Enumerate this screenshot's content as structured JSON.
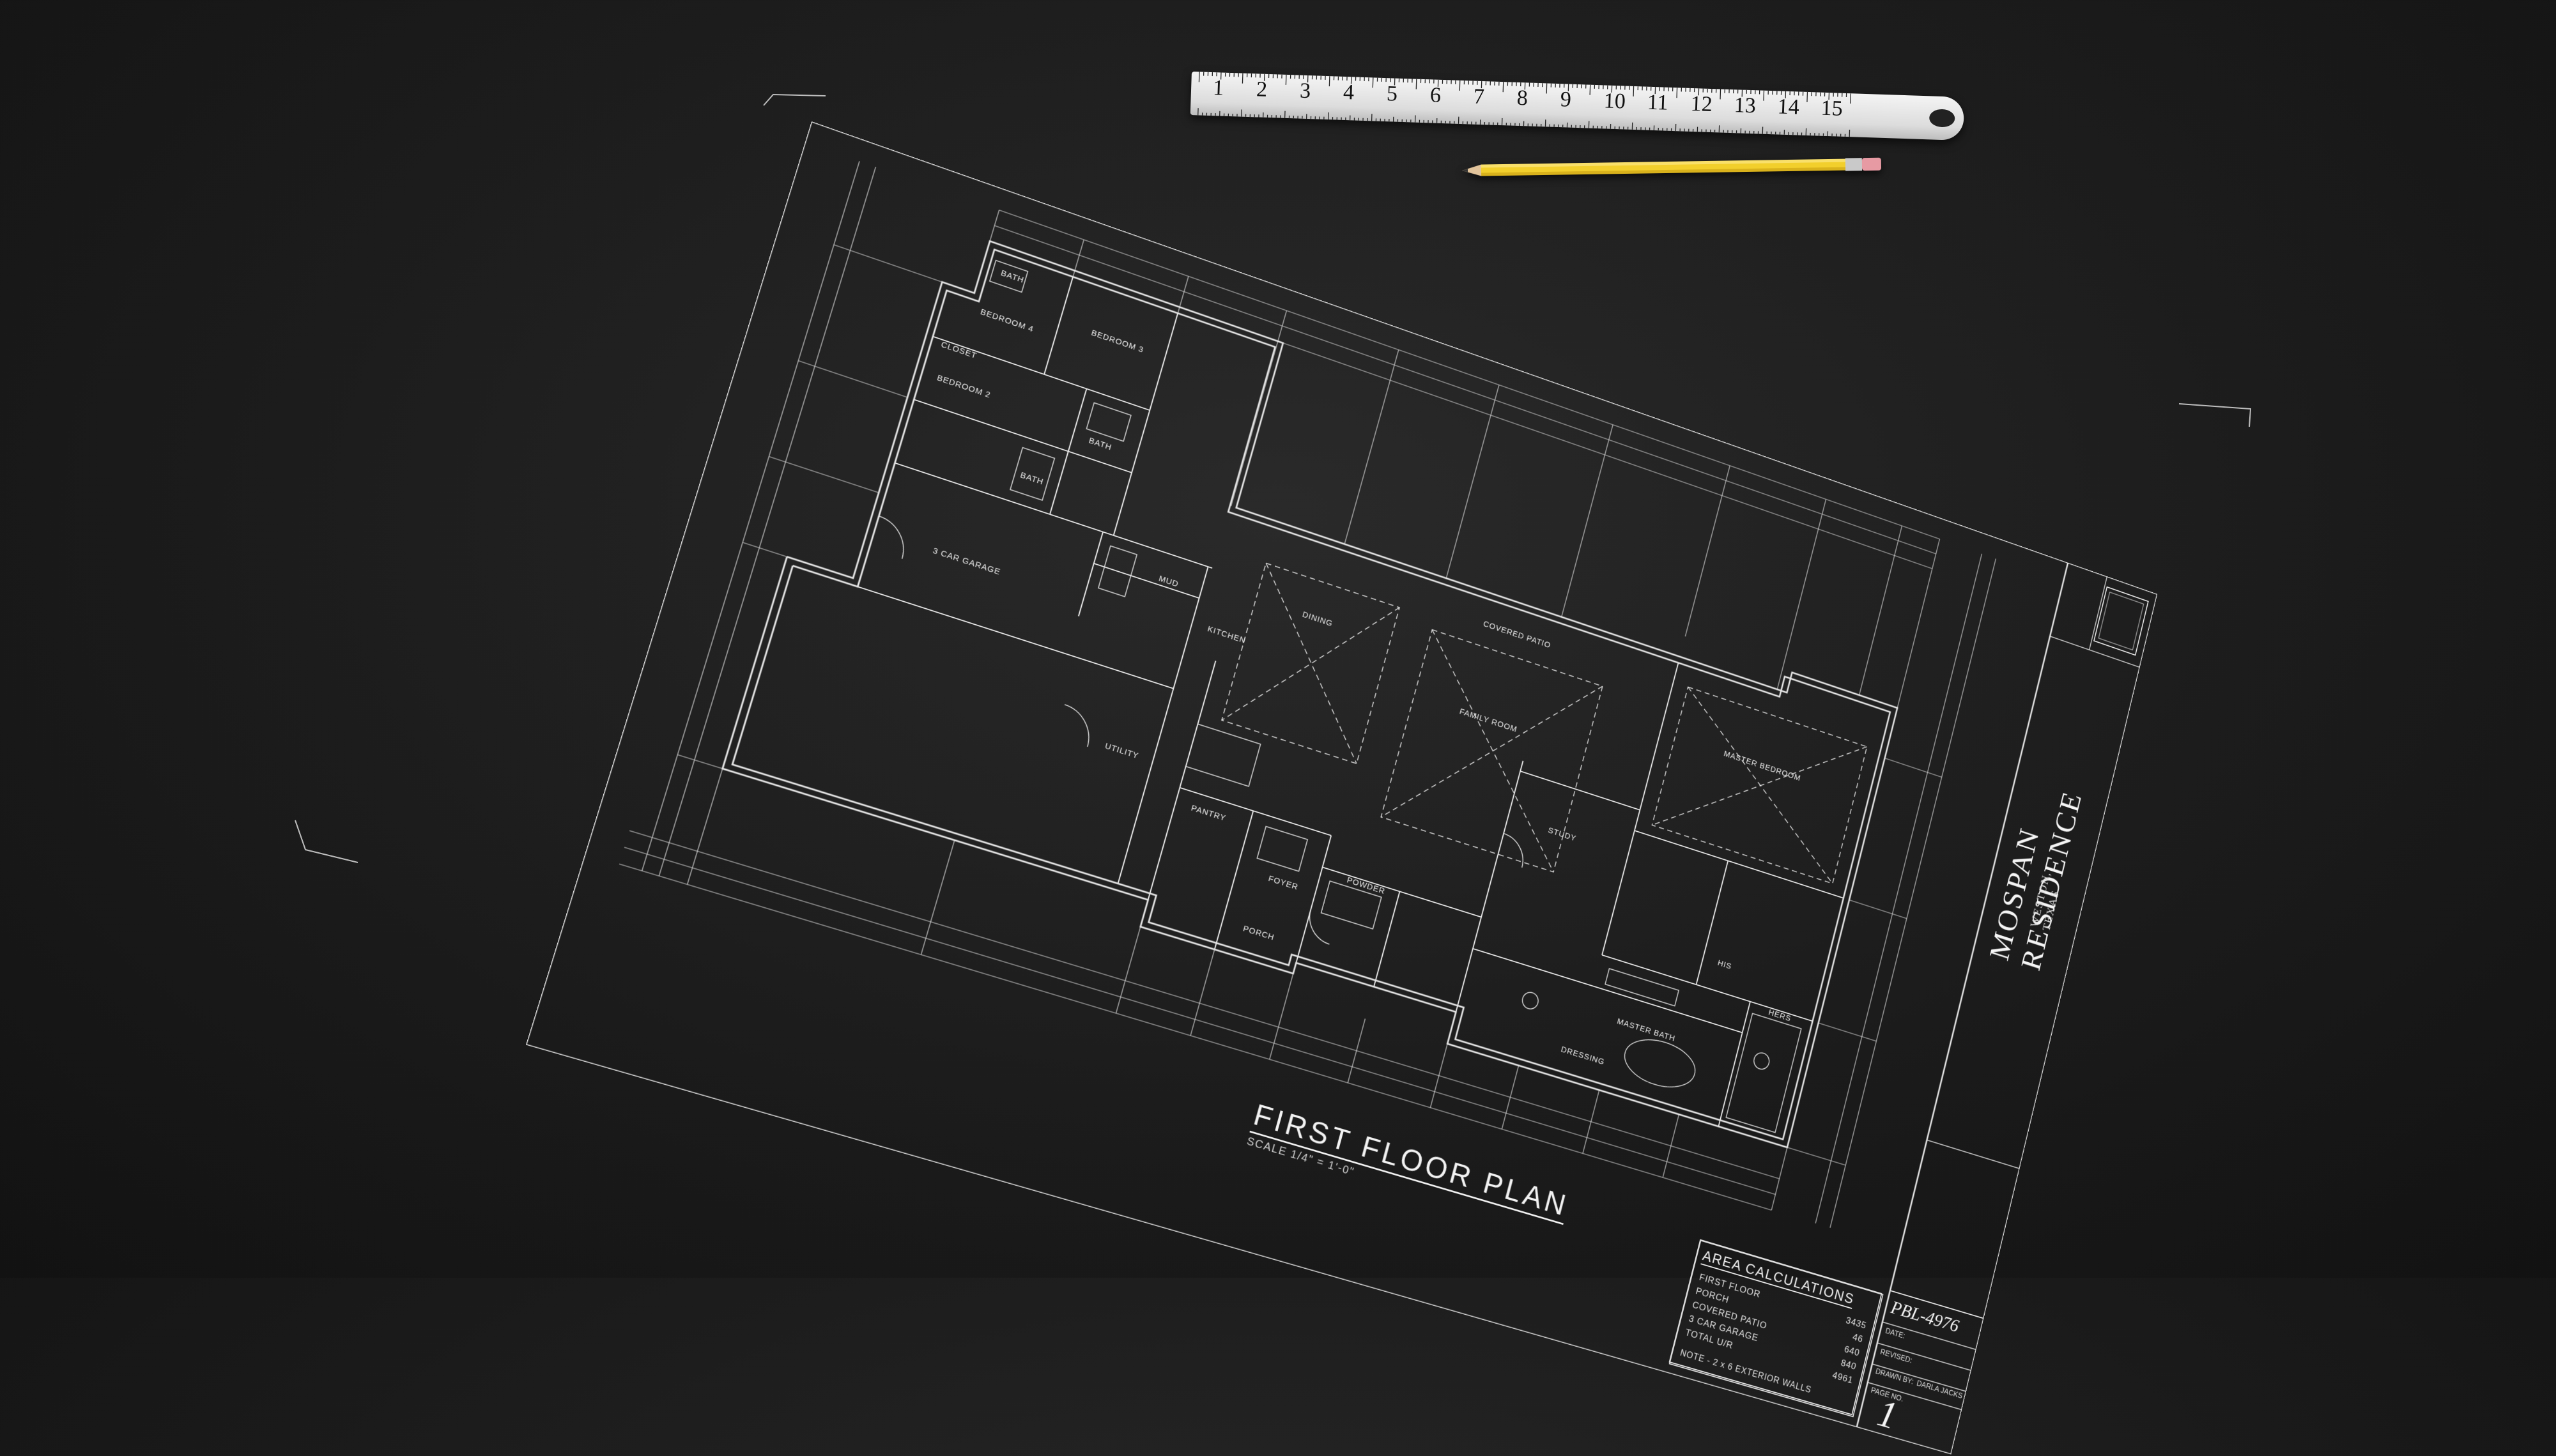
{
  "scene": {
    "background_color": "#1e1e1e",
    "line_color": "#e8e8e8",
    "ruler_color": "#e6e6e6",
    "pencil_color": "#f2cf2c",
    "eraser_color": "#e79aa3"
  },
  "ruler": {
    "numbers": [
      "1",
      "2",
      "3",
      "4",
      "5",
      "6",
      "7",
      "8",
      "9",
      "10",
      "11",
      "12",
      "13",
      "14",
      "15"
    ]
  },
  "plan": {
    "title": "FIRST FLOOR PLAN",
    "scale": "SCALE 1/4\" = 1'-0\"",
    "rooms": {
      "bath_upper": "BATH",
      "bedroom_4": "BEDROOM 4",
      "bedroom_3": "BEDROOM 3",
      "bedroom_2": "BEDROOM 2",
      "bath_mid": "BATH",
      "bath_lower": "BATH",
      "mud": "MUD",
      "garage": "3 CAR GARAGE",
      "covered_patio": "COVERED PATIO",
      "dining": "DINING",
      "kitchen": "KITCHEN",
      "family_room": "FAMILY ROOM",
      "study": "STUDY",
      "master_bedroom": "MASTER BEDROOM",
      "utility": "UTILITY",
      "pantry": "PANTRY",
      "foyer": "FOYER",
      "powder": "POWDER",
      "porch": "PORCH",
      "master_bath": "MASTER BATH",
      "hers": "HERS",
      "his": "HIS",
      "dressing": "DRESSING",
      "closet": "CLOSET"
    }
  },
  "titleblock": {
    "project_name": "MOSPAN RESIDENCE",
    "location": "WESTON, TEXAS",
    "plan_number": "PBL-4976",
    "date_label": "DATE:",
    "revised_label": "REVISED:",
    "drawn_label": "DRAWN BY:",
    "drawn_value": "DARLA JACKS",
    "page_label": "PAGE NO.",
    "page_number": "1"
  },
  "area_calculations": {
    "title": "AREA CALCULATIONS",
    "rows": [
      {
        "label": "FIRST FLOOR",
        "value": "3435"
      },
      {
        "label": "PORCH",
        "value": "46"
      },
      {
        "label": "COVERED PATIO",
        "value": "640"
      },
      {
        "label": "3 CAR GARAGE",
        "value": "840"
      },
      {
        "label": "TOTAL U/R",
        "value": "4961"
      }
    ],
    "note": "NOTE - 2 x 6 EXTERIOR WALLS"
  }
}
